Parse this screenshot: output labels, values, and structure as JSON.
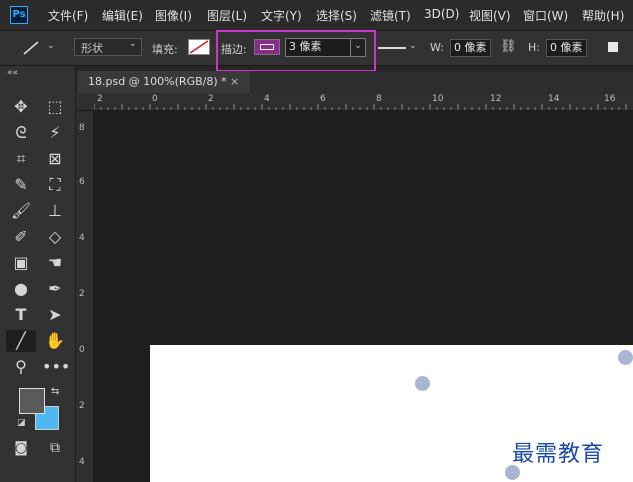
{
  "app": {
    "logo": "Ps"
  },
  "menu": [
    "文件(F)",
    "编辑(E)",
    "图像(I)",
    "图层(L)",
    "文字(Y)",
    "选择(S)",
    "滤镜(T)",
    "3D(D)",
    "视图(V)",
    "窗口(W)",
    "帮助(H)"
  ],
  "options": {
    "mode_value": "形状",
    "fill_label": "填充:",
    "stroke_label": "描边:",
    "stroke_width_value": "3 像素",
    "w_label": "W:",
    "w_value": "0 像素",
    "link_icon": "link-icon",
    "h_label": "H:",
    "h_value": "0 像素"
  },
  "document": {
    "tab_title": "18.psd @ 100%(RGB/8) *",
    "close": "×"
  },
  "rulers": {
    "top_ticks": [
      "2",
      "0",
      "2",
      "4",
      "6",
      "8",
      "10",
      "12",
      "14",
      "16"
    ],
    "left_ticks": [
      "8",
      "6",
      "4",
      "2",
      "0",
      "2",
      "4"
    ]
  },
  "toolbar": {
    "collapse": "««",
    "tools": [
      "move-tool-icon",
      "marquee-tool-icon",
      "lasso-tool-icon",
      "magic-wand-tool-icon",
      "crop-tool-icon",
      "frame-tool-icon",
      "eyedropper-tool-icon",
      "patch-tool-icon",
      "brush-tool-icon",
      "clone-stamp-tool-icon",
      "history-brush-tool-icon",
      "eraser-tool-icon",
      "gradient-tool-icon",
      "smudge-tool-icon",
      "dodge-tool-icon",
      "pen-tool-icon",
      "type-tool-icon",
      "path-selection-tool-icon",
      "line-tool-icon",
      "hand-tool-icon",
      "zoom-tool-icon",
      "more-tools-icon"
    ]
  },
  "colors": {
    "foreground": "#5a5a5a",
    "background": "#4fb8f0",
    "highlight": "#c837c8",
    "stroke_swatch": "#8a2c8c"
  },
  "watermark": "最需教育"
}
